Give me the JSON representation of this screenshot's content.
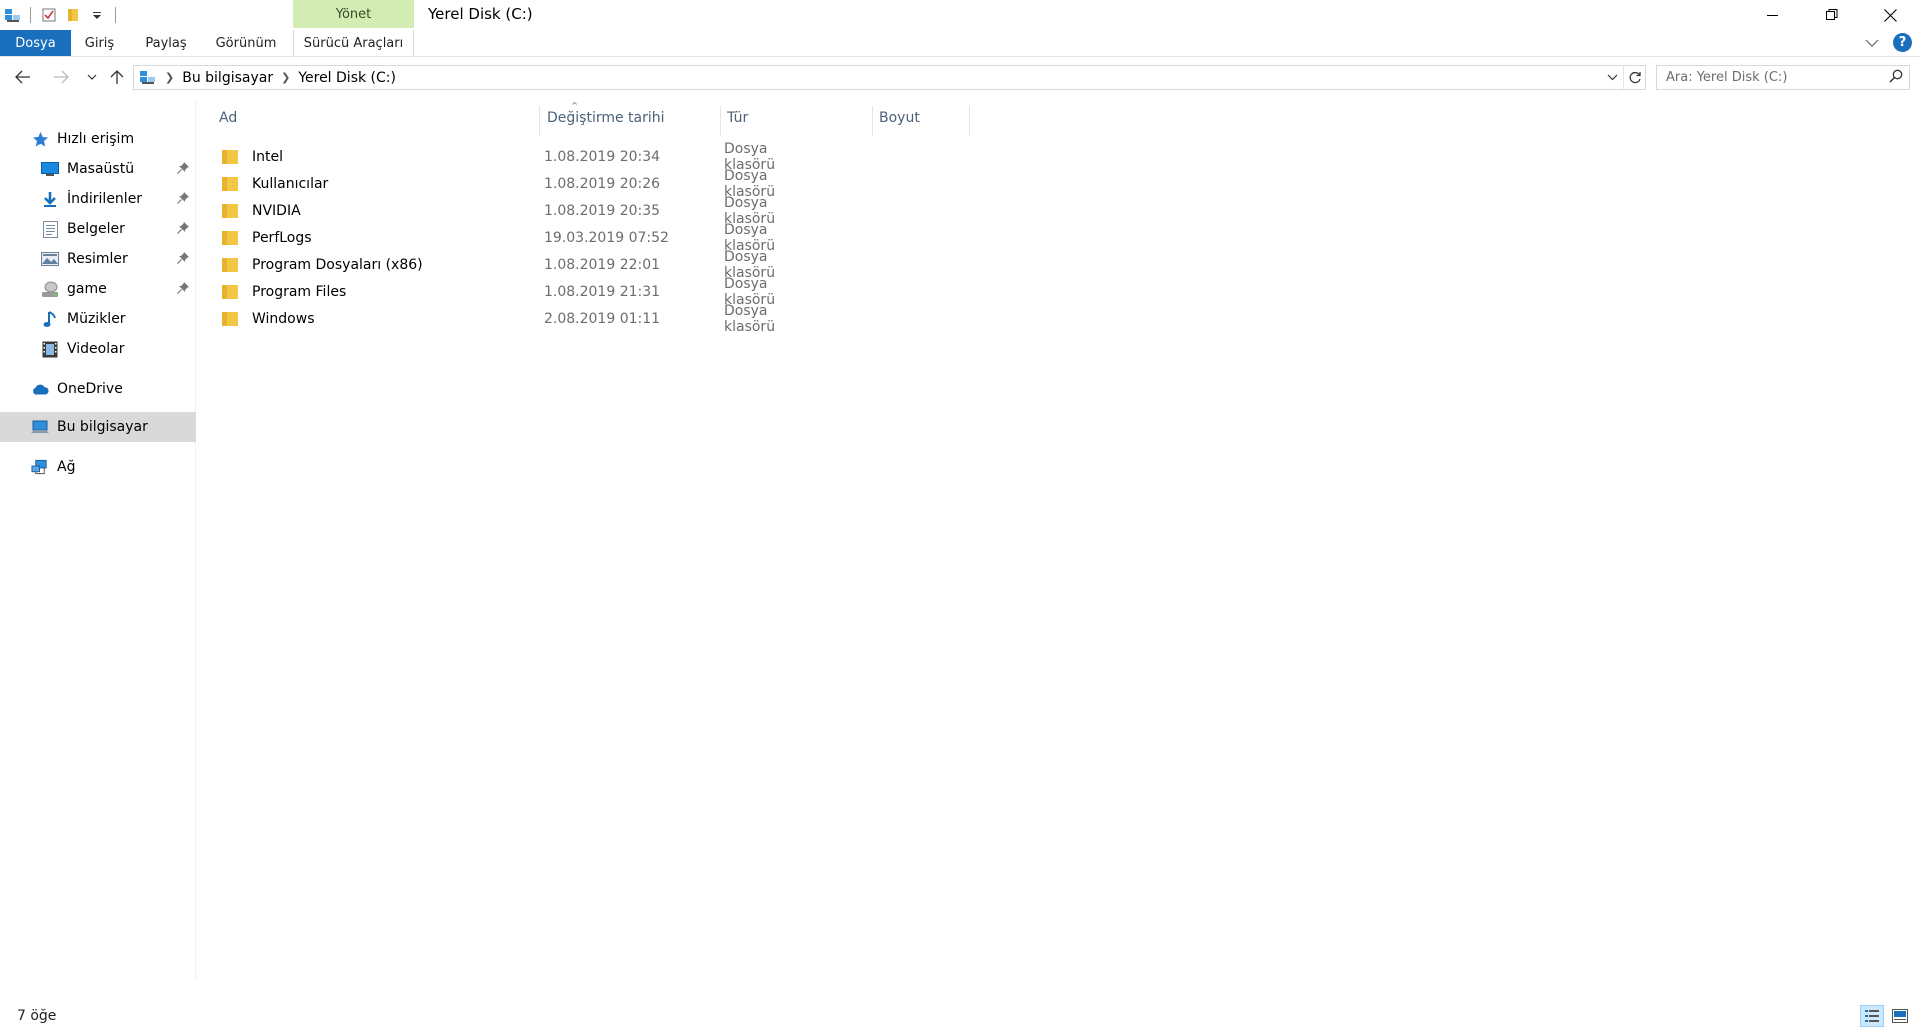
{
  "window": {
    "title": "Yerel Disk (C:)",
    "context_tab_group": "Yönet"
  },
  "ribbon": {
    "tabs": [
      {
        "label": "Dosya",
        "active": true
      },
      {
        "label": "Giriş"
      },
      {
        "label": "Paylaş"
      },
      {
        "label": "Görünüm"
      },
      {
        "label": "Sürücü Araçları"
      }
    ],
    "help_label": "?"
  },
  "address": {
    "crumbs": [
      "Bu bilgisayar",
      "Yerel Disk (C:)"
    ]
  },
  "search": {
    "placeholder": "Ara: Yerel Disk (C:)"
  },
  "navpane": {
    "quick_access": "Hızlı erişim",
    "quick_items": [
      {
        "label": "Masaüstü",
        "icon": "desktop-icon",
        "pinned": true
      },
      {
        "label": "İndirilenler",
        "icon": "downloads-icon",
        "pinned": true
      },
      {
        "label": "Belgeler",
        "icon": "documents-icon",
        "pinned": true
      },
      {
        "label": "Resimler",
        "icon": "pictures-icon",
        "pinned": true
      },
      {
        "label": "game",
        "icon": "drive-icon",
        "pinned": true
      },
      {
        "label": "Müzikler",
        "icon": "music-icon",
        "pinned": false
      },
      {
        "label": "Videolar",
        "icon": "videos-icon",
        "pinned": false
      }
    ],
    "onedrive": "OneDrive",
    "this_pc": "Bu bilgisayar",
    "network": "Ağ"
  },
  "columns": {
    "name": "Ad",
    "date": "Değiştirme tarihi",
    "type": "Tür",
    "size": "Boyut"
  },
  "files": [
    {
      "name": "Intel",
      "date": "1.08.2019 20:34",
      "type": "Dosya klasörü"
    },
    {
      "name": "Kullanıcılar",
      "date": "1.08.2019 20:26",
      "type": "Dosya klasörü"
    },
    {
      "name": "NVIDIA",
      "date": "1.08.2019 20:35",
      "type": "Dosya klasörü"
    },
    {
      "name": "PerfLogs",
      "date": "19.03.2019 07:52",
      "type": "Dosya klasörü"
    },
    {
      "name": "Program Dosyaları (x86)",
      "date": "1.08.2019 22:01",
      "type": "Dosya klasörü"
    },
    {
      "name": "Program Files",
      "date": "1.08.2019 21:31",
      "type": "Dosya klasörü"
    },
    {
      "name": "Windows",
      "date": "2.08.2019 01:11",
      "type": "Dosya klasörü"
    }
  ],
  "status": {
    "count": "7 öğe"
  },
  "colors": {
    "accent": "#1a6fbd",
    "context_tab": "#d2ecb4",
    "folder": "#f3c746",
    "selection": "#d9d9d9"
  }
}
